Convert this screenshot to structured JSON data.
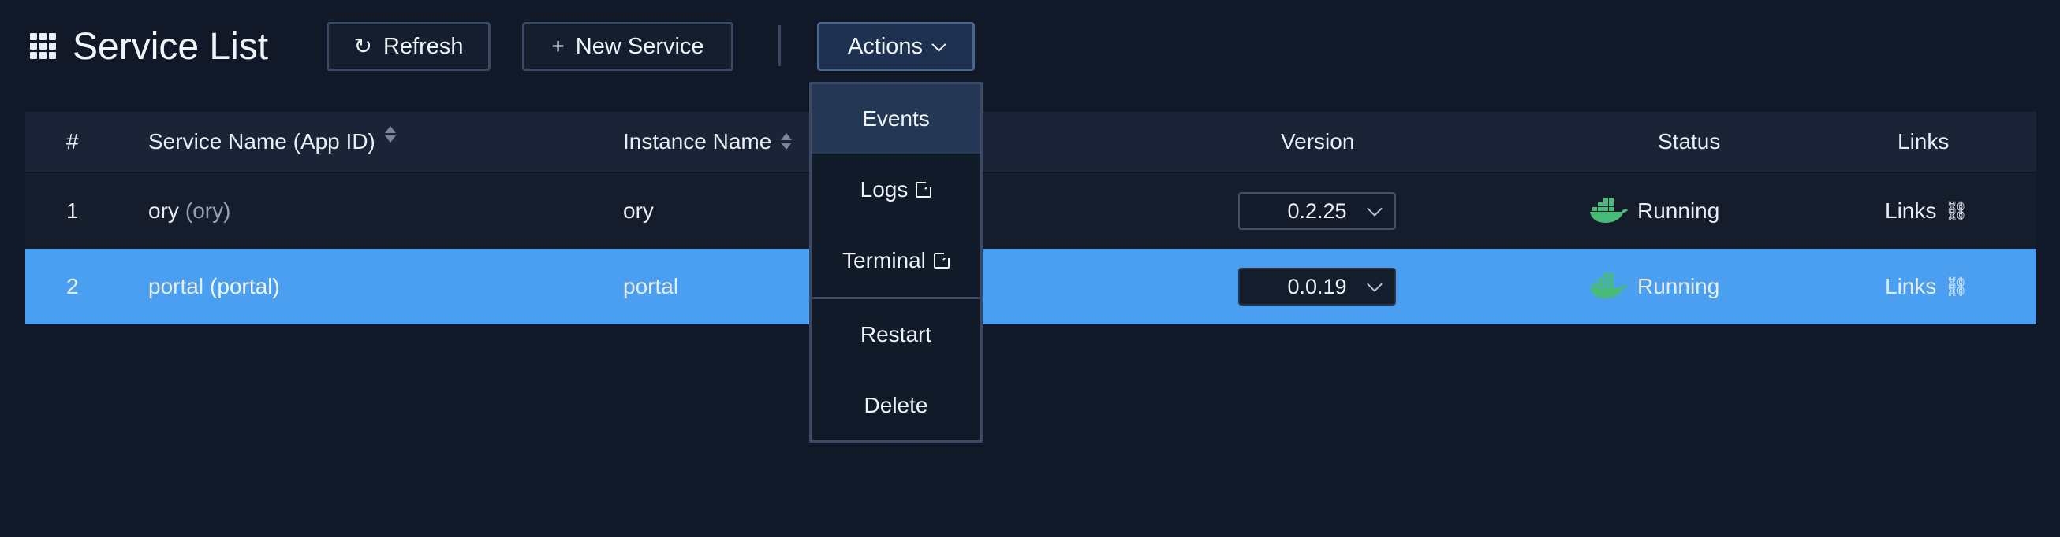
{
  "header": {
    "title": "Service List",
    "refresh_label": "Refresh",
    "new_service_label": "New Service",
    "actions_label": "Actions"
  },
  "actions_menu": {
    "items": [
      "Events",
      "Logs",
      "Terminal",
      "Restart",
      "Delete"
    ],
    "active_item": "Events"
  },
  "table": {
    "columns": [
      "#",
      "Service Name (App ID)",
      "Instance Name",
      "Version",
      "Status",
      "Links"
    ],
    "rows": [
      {
        "index": "1",
        "service_name": "ory",
        "app_id": "(ory)",
        "instance_name": "ory",
        "version": "0.2.25",
        "status": "Running",
        "links_label": "Links",
        "selected": false
      },
      {
        "index": "2",
        "service_name": "portal",
        "app_id": "(portal)",
        "instance_name": "portal",
        "version": "0.0.19",
        "status": "Running",
        "links_label": "Links",
        "selected": true
      }
    ]
  },
  "colors": {
    "background": "#111827",
    "selected_row": "#4a9ff0",
    "running_icon": "#48bb78",
    "button_border": "#3a4a64"
  }
}
